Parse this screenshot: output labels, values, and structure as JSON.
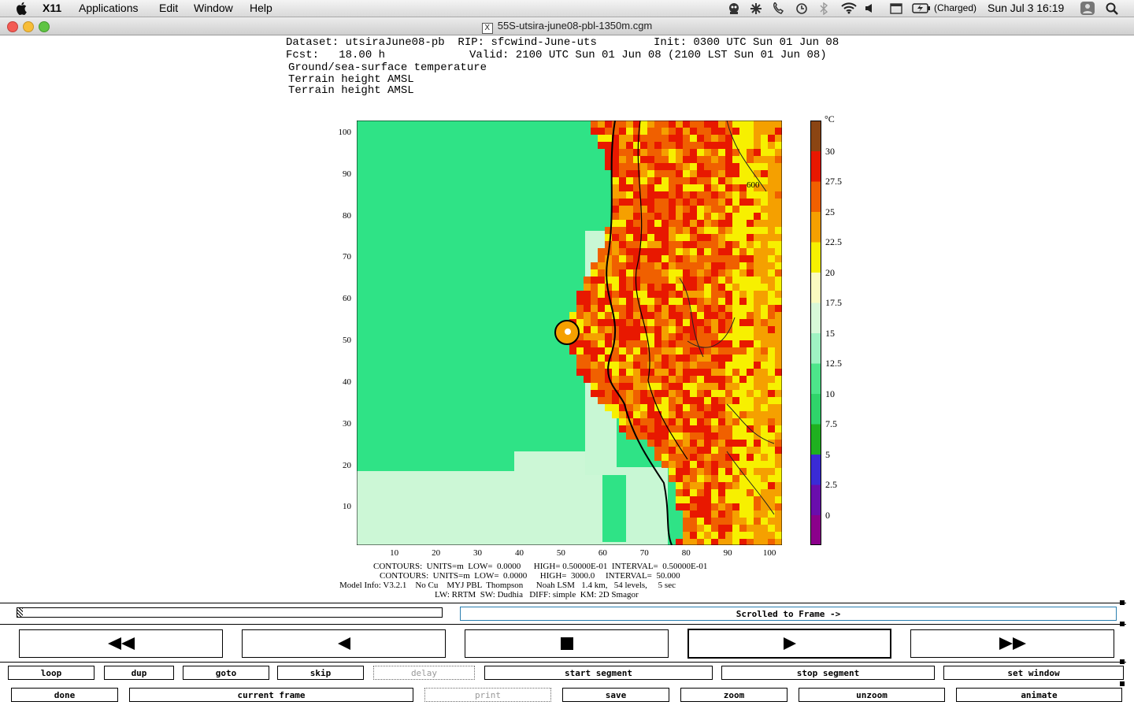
{
  "menubar": {
    "app": "X11",
    "items": [
      "Applications",
      "Edit",
      "Window",
      "Help"
    ],
    "battery": "(Charged)",
    "clock": "Sun Jul 3  16:19"
  },
  "window": {
    "title": "55S-utsira-june08-pbl-1350m.cgm"
  },
  "plot": {
    "header": {
      "dataset": "Dataset: utsiraJune08-pb  RIP: sfcwind-June-uts",
      "init": "Init: 0300 UTC Sun 01 Jun 08",
      "fcst": "Fcst:   18.00 h",
      "valid": "Valid: 2100 UTC Sun 01 Jun 08 (2100 LST Sun 01 Jun 08)",
      "field1": "Ground/sea-surface temperature",
      "field2": "Terrain height AMSL",
      "field3": "Terrain height AMSL"
    },
    "colorbar_unit": "°C",
    "contour_label": "600",
    "footer": {
      "line1": "CONTOURS:  UNITS=m  LOW=  0.0000      HIGH= 0.50000E-01  INTERVAL=  0.50000E-01",
      "line2": "CONTOURS:  UNITS=m  LOW=  0.0000      HIGH=  3000.0     INTERVAL=  50.000",
      "line3": "Model Info: V3.2.1    No Cu    MYJ PBL  Thompson      Noah LSM   1.4 km,   54 levels,     5 sec",
      "line4": "LW: RRTM  SW: Dudhia   DIFF: simple  KM: 2D Smagor"
    }
  },
  "chart_data": {
    "type": "heatmap",
    "title": "Ground/sea-surface temperature",
    "x_ticks": [
      10,
      20,
      30,
      40,
      50,
      60,
      70,
      80,
      90,
      100
    ],
    "y_ticks": [
      10,
      20,
      30,
      40,
      50,
      60,
      70,
      80,
      90,
      100
    ],
    "xlim": [
      1,
      103
    ],
    "ylim": [
      1,
      103
    ],
    "colorbar": {
      "unit": "°C",
      "levels": [
        0,
        2.5,
        5,
        7.5,
        10,
        12.5,
        15,
        17.5,
        20,
        22.5,
        25,
        27.5,
        30
      ],
      "colors": [
        "#8b008b",
        "#6a0dad",
        "#3a2bd6",
        "#1fb01f",
        "#2fd46a",
        "#4de58a",
        "#9ff2c2",
        "#d8f8d8",
        "#fbfbbf",
        "#f7f000",
        "#f5a000",
        "#f06000",
        "#e81800",
        "#8b4513"
      ]
    }
  },
  "controls": {
    "scroll_label": "Scrolled to Frame ->",
    "row1": [
      "loop",
      "dup",
      "goto",
      "skip",
      "delay",
      "start segment",
      "stop segment",
      "set window"
    ],
    "row2": [
      "done",
      "current frame",
      "print",
      "save",
      "zoom",
      "unzoom",
      "animate"
    ]
  }
}
